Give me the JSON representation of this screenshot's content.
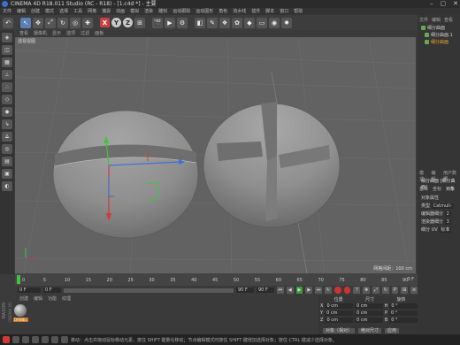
{
  "window": {
    "title": "CINEMA 4D R18.011 Studio (RC - R18) - [1.c4d *] - 主要"
  },
  "menubar": [
    "文件",
    "编辑",
    "创建",
    "模式",
    "选择",
    "工具",
    "网格",
    "捕捉",
    "动画",
    "模拟",
    "渲染",
    "雕刻",
    "运动跟踪",
    "运动图形",
    "角色",
    "流水线",
    "插件",
    "脚本",
    "窗口",
    "帮助"
  ],
  "toolbar": {
    "axes": [
      "X",
      "Y",
      "Z"
    ]
  },
  "viewport": {
    "menu": [
      "查看",
      "摄像机",
      "显示",
      "选项",
      "过滤",
      "面板"
    ],
    "label": "透视视图",
    "grid_size": "网格间距：100 cm"
  },
  "timeline": {
    "ticks": [
      "0",
      "5",
      "10",
      "15",
      "20",
      "25",
      "30",
      "35",
      "40",
      "45",
      "50",
      "55",
      "60",
      "65",
      "70",
      "75",
      "80",
      "85",
      "90"
    ],
    "end_label": "0 F",
    "start_frame": "0 F",
    "current_frame": "0 F",
    "max_frame": "90 F",
    "end_frame": "90 F"
  },
  "materials": {
    "menu": [
      "创建",
      "编辑",
      "功能",
      "纹理"
    ],
    "brand": "MAXON",
    "product": "CINEMA 4D",
    "swatch_label": "DANIEL"
  },
  "coords": {
    "headers": [
      "位置",
      "尺寸",
      "旋转"
    ],
    "rows": [
      {
        "axis": "X",
        "pos": "0 cm",
        "size": "0 cm",
        "rot_axis": "H",
        "rot": "0 °"
      },
      {
        "axis": "Y",
        "pos": "0 cm",
        "size": "0 cm",
        "rot_axis": "P",
        "rot": "0 °"
      },
      {
        "axis": "Z",
        "pos": "0 cm",
        "size": "0 cm",
        "rot_axis": "B",
        "rot": "0 °"
      }
    ],
    "mode_select": "对象（相对）",
    "size_select": "绝对尺寸",
    "apply_button": "应用"
  },
  "objects": {
    "menu": [
      "文件",
      "编辑",
      "查看"
    ],
    "items": [
      "细分曲面",
      "细分曲面.1",
      "细分曲面"
    ]
  },
  "attributes": {
    "menu": [
      "模式",
      "编辑",
      "用户数据"
    ],
    "object_name": "细分曲面 [细分曲面]",
    "tabs": [
      "基本",
      "坐标",
      "对象"
    ],
    "section": "对象属性",
    "rows": [
      {
        "label": "类型",
        "value": "Catmull-"
      },
      {
        "label": "编辑器细分",
        "value": "2"
      },
      {
        "label": "渲染器细分",
        "value": "3"
      },
      {
        "label": "细分 UV",
        "value": "标准"
      }
    ]
  },
  "status": {
    "text": "移动：点击并拖动鼠标移动元素。按住 SHIFT 键量化移动；节点编辑模式时按住 SHIFT 键增加选择对象；按住 CTRL 键减少选择对象。"
  },
  "colors": {
    "accent": "#5b7fb5",
    "axis_x": "#d23a3a",
    "axis_y": "#3ec43e",
    "axis_z": "#3a6fd6",
    "selected": "#f0a030"
  }
}
